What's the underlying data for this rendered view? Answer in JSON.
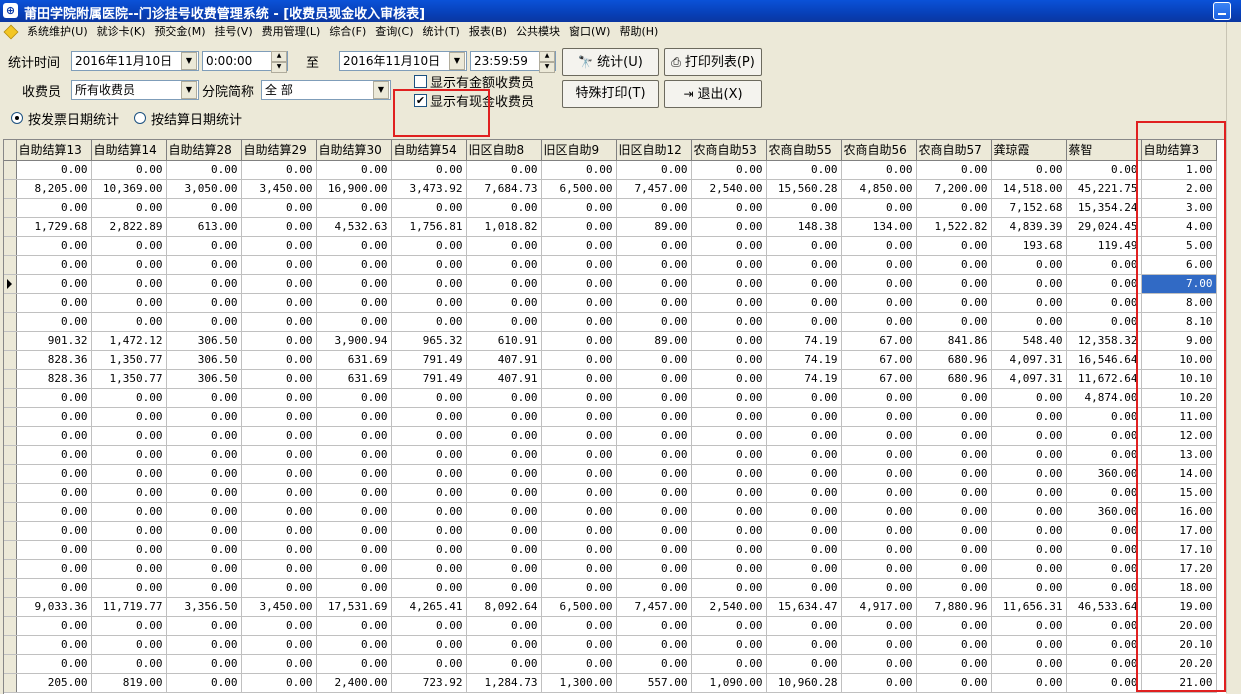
{
  "window": {
    "title": "莆田学院附属医院--门诊挂号收费管理系统 - [收费员现金收入审核表]",
    "app_icon": "hospital-logo-icon"
  },
  "menu": [
    "系统维护(U)",
    "就诊卡(K)",
    "预交金(M)",
    "挂号(V)",
    "费用管理(L)",
    "综合(F)",
    "查询(C)",
    "统计(T)",
    "报表(B)",
    "公共模块",
    "窗口(W)",
    "帮助(H)"
  ],
  "filters": {
    "period_label": "统计时间",
    "start_date": "2016年11月10日",
    "start_time": "0:00:00",
    "to_label": "至",
    "end_date": "2016年11月10日",
    "end_time": "23:59:59",
    "cashier_label": "收费员",
    "cashier_value": "所有收费员",
    "branch_label": "分院简称",
    "branch_value": "全 部",
    "show_amount_label": "显示有金额收费员",
    "show_amount_checked": false,
    "show_cash_label": "显示有现金收费员",
    "show_cash_checked": true,
    "radio_invoice_label": "按发票日期统计",
    "radio_settle_label": "按结算日期统计",
    "radio_selected": "invoice"
  },
  "buttons": {
    "stat": "统计(U)",
    "print_list": "打印列表(P)",
    "special_print": "特殊打印(T)",
    "exit": "退出(X)"
  },
  "table": {
    "columns": [
      "自助结算13",
      "自助结算14",
      "自助结算28",
      "自助结算29",
      "自助结算30",
      "自助结算54",
      "旧区自助8",
      "旧区自助9",
      "旧区自助12",
      "农商自助53",
      "农商自助55",
      "农商自助56",
      "农商自助57",
      "龚琼霞",
      "蔡智",
      "自助结算3"
    ],
    "selected_row": 6,
    "rows": [
      [
        "0.00",
        "0.00",
        "0.00",
        "0.00",
        "0.00",
        "0.00",
        "0.00",
        "0.00",
        "0.00",
        "0.00",
        "0.00",
        "0.00",
        "0.00",
        "0.00",
        "0.00",
        "1.00"
      ],
      [
        "8,205.00",
        "10,369.00",
        "3,050.00",
        "3,450.00",
        "16,900.00",
        "3,473.92",
        "7,684.73",
        "6,500.00",
        "7,457.00",
        "2,540.00",
        "15,560.28",
        "4,850.00",
        "7,200.00",
        "14,518.00",
        "45,221.75",
        "2.00"
      ],
      [
        "0.00",
        "0.00",
        "0.00",
        "0.00",
        "0.00",
        "0.00",
        "0.00",
        "0.00",
        "0.00",
        "0.00",
        "0.00",
        "0.00",
        "0.00",
        "7,152.68",
        "15,354.24",
        "3.00"
      ],
      [
        "1,729.68",
        "2,822.89",
        "613.00",
        "0.00",
        "4,532.63",
        "1,756.81",
        "1,018.82",
        "0.00",
        "89.00",
        "0.00",
        "148.38",
        "134.00",
        "1,522.82",
        "4,839.39",
        "29,024.45",
        "4.00"
      ],
      [
        "0.00",
        "0.00",
        "0.00",
        "0.00",
        "0.00",
        "0.00",
        "0.00",
        "0.00",
        "0.00",
        "0.00",
        "0.00",
        "0.00",
        "0.00",
        "193.68",
        "119.49",
        "5.00"
      ],
      [
        "0.00",
        "0.00",
        "0.00",
        "0.00",
        "0.00",
        "0.00",
        "0.00",
        "0.00",
        "0.00",
        "0.00",
        "0.00",
        "0.00",
        "0.00",
        "0.00",
        "0.00",
        "6.00"
      ],
      [
        "0.00",
        "0.00",
        "0.00",
        "0.00",
        "0.00",
        "0.00",
        "0.00",
        "0.00",
        "0.00",
        "0.00",
        "0.00",
        "0.00",
        "0.00",
        "0.00",
        "0.00",
        "7.00"
      ],
      [
        "0.00",
        "0.00",
        "0.00",
        "0.00",
        "0.00",
        "0.00",
        "0.00",
        "0.00",
        "0.00",
        "0.00",
        "0.00",
        "0.00",
        "0.00",
        "0.00",
        "0.00",
        "8.00"
      ],
      [
        "0.00",
        "0.00",
        "0.00",
        "0.00",
        "0.00",
        "0.00",
        "0.00",
        "0.00",
        "0.00",
        "0.00",
        "0.00",
        "0.00",
        "0.00",
        "0.00",
        "0.00",
        "8.10"
      ],
      [
        "901.32",
        "1,472.12",
        "306.50",
        "0.00",
        "3,900.94",
        "965.32",
        "610.91",
        "0.00",
        "89.00",
        "0.00",
        "74.19",
        "67.00",
        "841.86",
        "548.40",
        "12,358.32",
        "9.00"
      ],
      [
        "828.36",
        "1,350.77",
        "306.50",
        "0.00",
        "631.69",
        "791.49",
        "407.91",
        "0.00",
        "0.00",
        "0.00",
        "74.19",
        "67.00",
        "680.96",
        "4,097.31",
        "16,546.64",
        "10.00"
      ],
      [
        "828.36",
        "1,350.77",
        "306.50",
        "0.00",
        "631.69",
        "791.49",
        "407.91",
        "0.00",
        "0.00",
        "0.00",
        "74.19",
        "67.00",
        "680.96",
        "4,097.31",
        "11,672.64",
        "10.10"
      ],
      [
        "0.00",
        "0.00",
        "0.00",
        "0.00",
        "0.00",
        "0.00",
        "0.00",
        "0.00",
        "0.00",
        "0.00",
        "0.00",
        "0.00",
        "0.00",
        "0.00",
        "4,874.00",
        "10.20"
      ],
      [
        "0.00",
        "0.00",
        "0.00",
        "0.00",
        "0.00",
        "0.00",
        "0.00",
        "0.00",
        "0.00",
        "0.00",
        "0.00",
        "0.00",
        "0.00",
        "0.00",
        "0.00",
        "11.00"
      ],
      [
        "0.00",
        "0.00",
        "0.00",
        "0.00",
        "0.00",
        "0.00",
        "0.00",
        "0.00",
        "0.00",
        "0.00",
        "0.00",
        "0.00",
        "0.00",
        "0.00",
        "0.00",
        "12.00"
      ],
      [
        "0.00",
        "0.00",
        "0.00",
        "0.00",
        "0.00",
        "0.00",
        "0.00",
        "0.00",
        "0.00",
        "0.00",
        "0.00",
        "0.00",
        "0.00",
        "0.00",
        "0.00",
        "13.00"
      ],
      [
        "0.00",
        "0.00",
        "0.00",
        "0.00",
        "0.00",
        "0.00",
        "0.00",
        "0.00",
        "0.00",
        "0.00",
        "0.00",
        "0.00",
        "0.00",
        "0.00",
        "360.00",
        "14.00"
      ],
      [
        "0.00",
        "0.00",
        "0.00",
        "0.00",
        "0.00",
        "0.00",
        "0.00",
        "0.00",
        "0.00",
        "0.00",
        "0.00",
        "0.00",
        "0.00",
        "0.00",
        "0.00",
        "15.00"
      ],
      [
        "0.00",
        "0.00",
        "0.00",
        "0.00",
        "0.00",
        "0.00",
        "0.00",
        "0.00",
        "0.00",
        "0.00",
        "0.00",
        "0.00",
        "0.00",
        "0.00",
        "360.00",
        "16.00"
      ],
      [
        "0.00",
        "0.00",
        "0.00",
        "0.00",
        "0.00",
        "0.00",
        "0.00",
        "0.00",
        "0.00",
        "0.00",
        "0.00",
        "0.00",
        "0.00",
        "0.00",
        "0.00",
        "17.00"
      ],
      [
        "0.00",
        "0.00",
        "0.00",
        "0.00",
        "0.00",
        "0.00",
        "0.00",
        "0.00",
        "0.00",
        "0.00",
        "0.00",
        "0.00",
        "0.00",
        "0.00",
        "0.00",
        "17.10"
      ],
      [
        "0.00",
        "0.00",
        "0.00",
        "0.00",
        "0.00",
        "0.00",
        "0.00",
        "0.00",
        "0.00",
        "0.00",
        "0.00",
        "0.00",
        "0.00",
        "0.00",
        "0.00",
        "17.20"
      ],
      [
        "0.00",
        "0.00",
        "0.00",
        "0.00",
        "0.00",
        "0.00",
        "0.00",
        "0.00",
        "0.00",
        "0.00",
        "0.00",
        "0.00",
        "0.00",
        "0.00",
        "0.00",
        "18.00"
      ],
      [
        "9,033.36",
        "11,719.77",
        "3,356.50",
        "3,450.00",
        "17,531.69",
        "4,265.41",
        "8,092.64",
        "6,500.00",
        "7,457.00",
        "2,540.00",
        "15,634.47",
        "4,917.00",
        "7,880.96",
        "11,656.31",
        "46,533.64",
        "19.00"
      ],
      [
        "0.00",
        "0.00",
        "0.00",
        "0.00",
        "0.00",
        "0.00",
        "0.00",
        "0.00",
        "0.00",
        "0.00",
        "0.00",
        "0.00",
        "0.00",
        "0.00",
        "0.00",
        "20.00"
      ],
      [
        "0.00",
        "0.00",
        "0.00",
        "0.00",
        "0.00",
        "0.00",
        "0.00",
        "0.00",
        "0.00",
        "0.00",
        "0.00",
        "0.00",
        "0.00",
        "0.00",
        "0.00",
        "20.10"
      ],
      [
        "0.00",
        "0.00",
        "0.00",
        "0.00",
        "0.00",
        "0.00",
        "0.00",
        "0.00",
        "0.00",
        "0.00",
        "0.00",
        "0.00",
        "0.00",
        "0.00",
        "0.00",
        "20.20"
      ],
      [
        "205.00",
        "819.00",
        "0.00",
        "0.00",
        "2,400.00",
        "723.92",
        "1,284.73",
        "1,300.00",
        "557.00",
        "1,090.00",
        "10,960.28",
        "0.00",
        "0.00",
        "0.00",
        "0.00",
        "21.00"
      ]
    ]
  }
}
